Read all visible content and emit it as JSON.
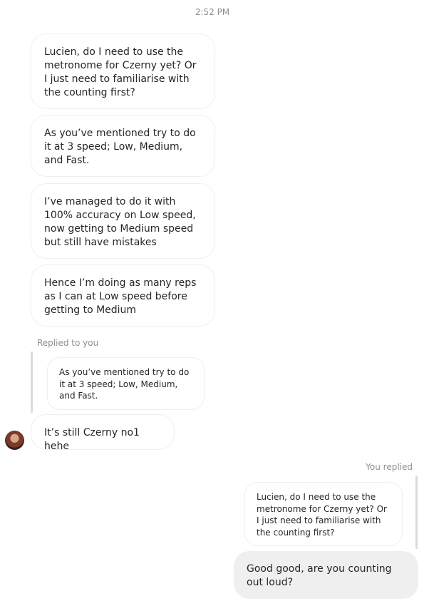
{
  "timestamp": "2:52 PM",
  "messages_in": [
    {
      "text": "Lucien, do I need to use the metronome for Czerny yet? Or I just need to familiarise with the counting first?"
    },
    {
      "text": "As you’ve mentioned try to do it at 3 speed; Low, Medium, and Fast."
    },
    {
      "text": "I’ve managed to do it with 100% accuracy on Low speed, now getting to Medium speed but still have mistakes"
    },
    {
      "text": "Hence I’m doing as many reps as I can at Low speed before getting to Medium"
    }
  ],
  "reply_in": {
    "label": "Replied to you",
    "quoted": "As you’ve mentioned try to do it at 3 speed; Low, Medium, and Fast.",
    "text": "It’s still Czerny no1 hehe"
  },
  "reply_out": {
    "label": "You replied",
    "quoted": "Lucien, do I need to use the metronome for Czerny yet? Or I just need to familiarise with the counting first?",
    "text": "Good good, are you counting out loud?"
  }
}
